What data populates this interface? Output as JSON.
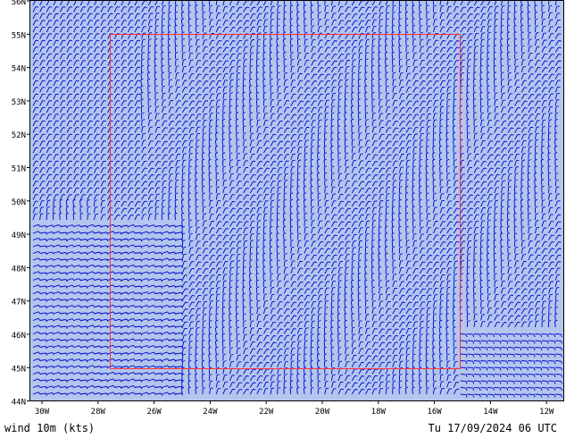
{
  "map": {
    "colors": {
      "background": "#b2c6ee",
      "barb": "#0000cc",
      "box": "#ff3333",
      "frame": "#000000",
      "text": "#000000"
    },
    "lat_labels": [
      "56N",
      "55N",
      "54N",
      "53N",
      "52N",
      "51N",
      "50N",
      "49N",
      "48N",
      "47N",
      "46N",
      "45N",
      "44N"
    ],
    "lon_labels": [
      "30W",
      "28W",
      "26W",
      "24W",
      "22W",
      "20W",
      "18W",
      "16W",
      "14W",
      "12W"
    ]
  },
  "footer": {
    "variable": "wind 10m (kts)",
    "datetime": "Tu 17/09/2024 06 UTC"
  }
}
